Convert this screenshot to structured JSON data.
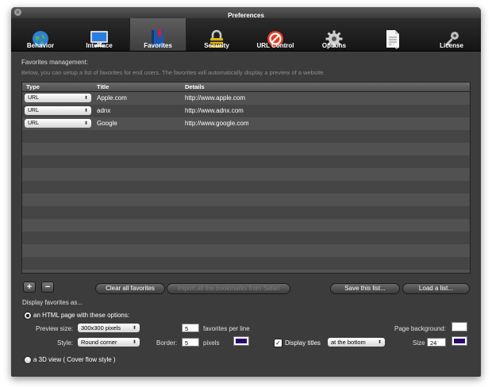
{
  "window": {
    "title": "Preferences"
  },
  "toolbar": {
    "items": [
      {
        "label": "Behavior"
      },
      {
        "label": "Interface"
      },
      {
        "label": "Favorites"
      },
      {
        "label": "Security"
      },
      {
        "label": "URL Control"
      },
      {
        "label": "Options"
      },
      {
        "label": "Log"
      },
      {
        "label": "License"
      }
    ],
    "selected": "Favorites"
  },
  "favorites": {
    "section_title": "Favorites management:",
    "description": "Below, you can setup a list of favorites for end users. The favorites will automatically display a preview of a website.",
    "columns": [
      "Type",
      "Title",
      "Details"
    ],
    "rows": [
      {
        "type": "URL",
        "title": "Apple.com",
        "details": "http://www.apple.com"
      },
      {
        "type": "URL",
        "title": "adnx",
        "details": "http://www.adnx.com"
      },
      {
        "type": "URL",
        "title": "Google",
        "details": "http://www.google.com"
      }
    ]
  },
  "buttons": {
    "add": "+",
    "remove": "−",
    "clear_all": "Clear all favorites",
    "import": "Import all the bookmarks from Safari",
    "save_list": "Save this list...",
    "load_list": "Load a list..."
  },
  "display": {
    "heading": "Display favorites as...",
    "html_option": "an HTML page with these options:",
    "preview_size_label": "Preview size:",
    "preview_size_value": "300x300 pixels",
    "per_line_value": "5",
    "per_line_label": "favorites per line",
    "page_background_label": "Page background:",
    "style_label": "Style:",
    "style_value": "Round corner",
    "border_label": "Border:",
    "border_value": "5",
    "pixels_label": "pixels",
    "display_titles_label": "Display titles",
    "display_titles_checked": true,
    "titles_position_value": "at the bottom",
    "size_label": "Size",
    "size_value": "24",
    "cover_flow_option": "a 3D view ( Cover flow style )",
    "border_color": "#2a0a6e",
    "page_background_color": "#ffffff",
    "title_color": "#2a0a6e"
  },
  "colors": {
    "window_bg": "#3c3c3c",
    "toolbar_bg": "#141414",
    "row_odd": "#515151",
    "row_even": "#454545"
  }
}
